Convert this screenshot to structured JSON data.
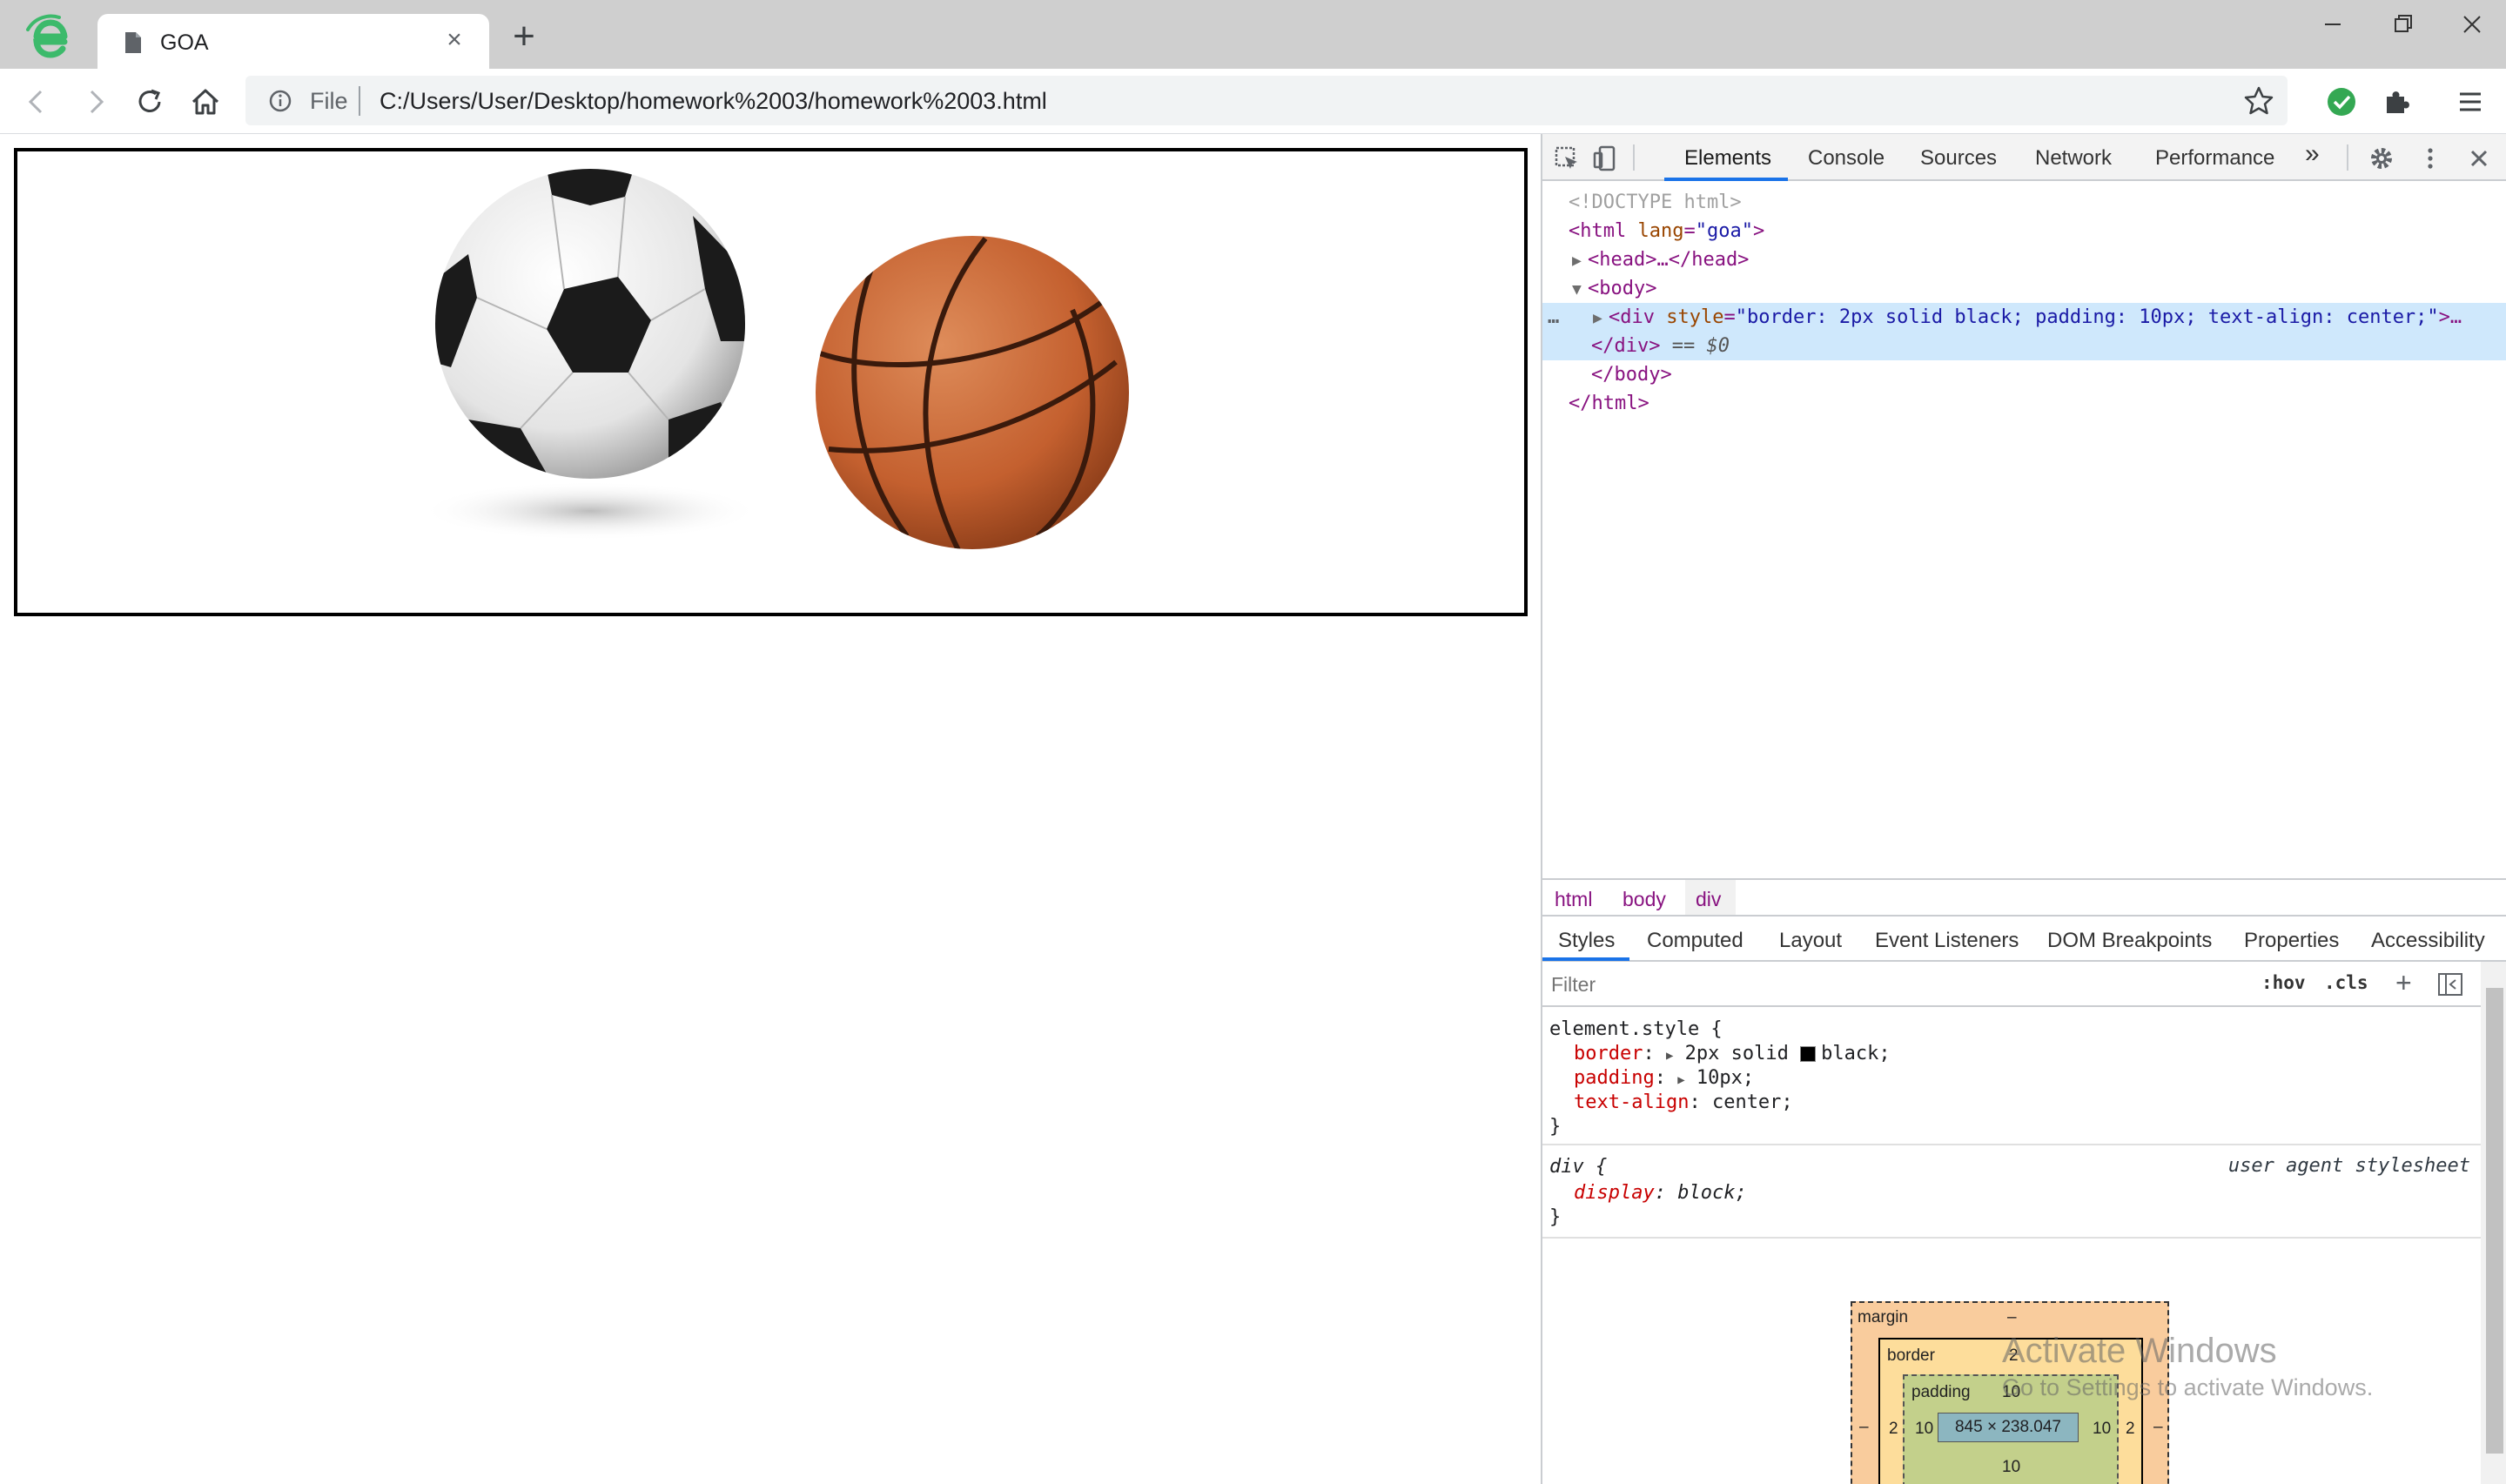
{
  "tab": {
    "title": "GOA",
    "close": "×",
    "new_tab": "+"
  },
  "toolbar": {
    "file_label": "File",
    "url": "C:/Users/User/Desktop/homework%2003/homework%2003.html"
  },
  "devtools": {
    "tabs": [
      "Elements",
      "Console",
      "Sources",
      "Network",
      "Performance"
    ],
    "more": "»",
    "dom": {
      "doctype": "<!DOCTYPE html>",
      "html_open_tag": "<html ",
      "html_attr": "lang",
      "html_attr_val": "\"goa\"",
      "head": "<head>…</head>",
      "body_open": "<body>",
      "div_tag": "<div ",
      "div_attr": "style",
      "div_attr_val": "\"border: 2px solid black; padding: 10px; text-align: center;\"",
      "div_tail": ">…",
      "div_close": "</div>",
      "div_ref": "== $0",
      "body_close": "</body>",
      "html_close": "</html>",
      "ellipsis": "…"
    },
    "breadcrumb": [
      "html",
      "body",
      "div"
    ],
    "styles_tabs": [
      "Styles",
      "Computed",
      "Layout",
      "Event Listeners",
      "DOM Breakpoints",
      "Properties",
      "Accessibility"
    ],
    "filter_placeholder": "Filter",
    "hov": ":hov",
    "cls": ".cls",
    "plus": "+",
    "rules": {
      "element_style": "element.style {",
      "border_prop": "border",
      "border_val": "2px solid",
      "border_color": "black;",
      "padding_prop": "padding",
      "padding_val": "10px;",
      "text_align_prop": "text-align",
      "text_align_val": "center;",
      "close_brace": "}",
      "div_selector": "div {",
      "ua_label": "user agent stylesheet",
      "display_prop": "display",
      "display_val": "block;"
    },
    "box_model": {
      "margin_label": "margin",
      "margin_val": "–",
      "border_label": "border",
      "border_val": "2",
      "padding_label": "padding",
      "padding_val": "10",
      "content": "845 × 238.047",
      "left_margin": "–",
      "left_border": "2",
      "left_padding": "10",
      "right_padding": "10",
      "right_border": "2",
      "right_margin": "–",
      "bottom_padding": "10"
    }
  },
  "watermark": {
    "title": "Activate Windows",
    "subtitle": "Go to Settings to activate Windows."
  },
  "colors": {
    "accent": "#1a73e8",
    "tag": "#881280",
    "attr": "#994500",
    "value": "#1a1aa6",
    "css_prop": "#c80000",
    "selected_row": "#cfe8fc"
  }
}
